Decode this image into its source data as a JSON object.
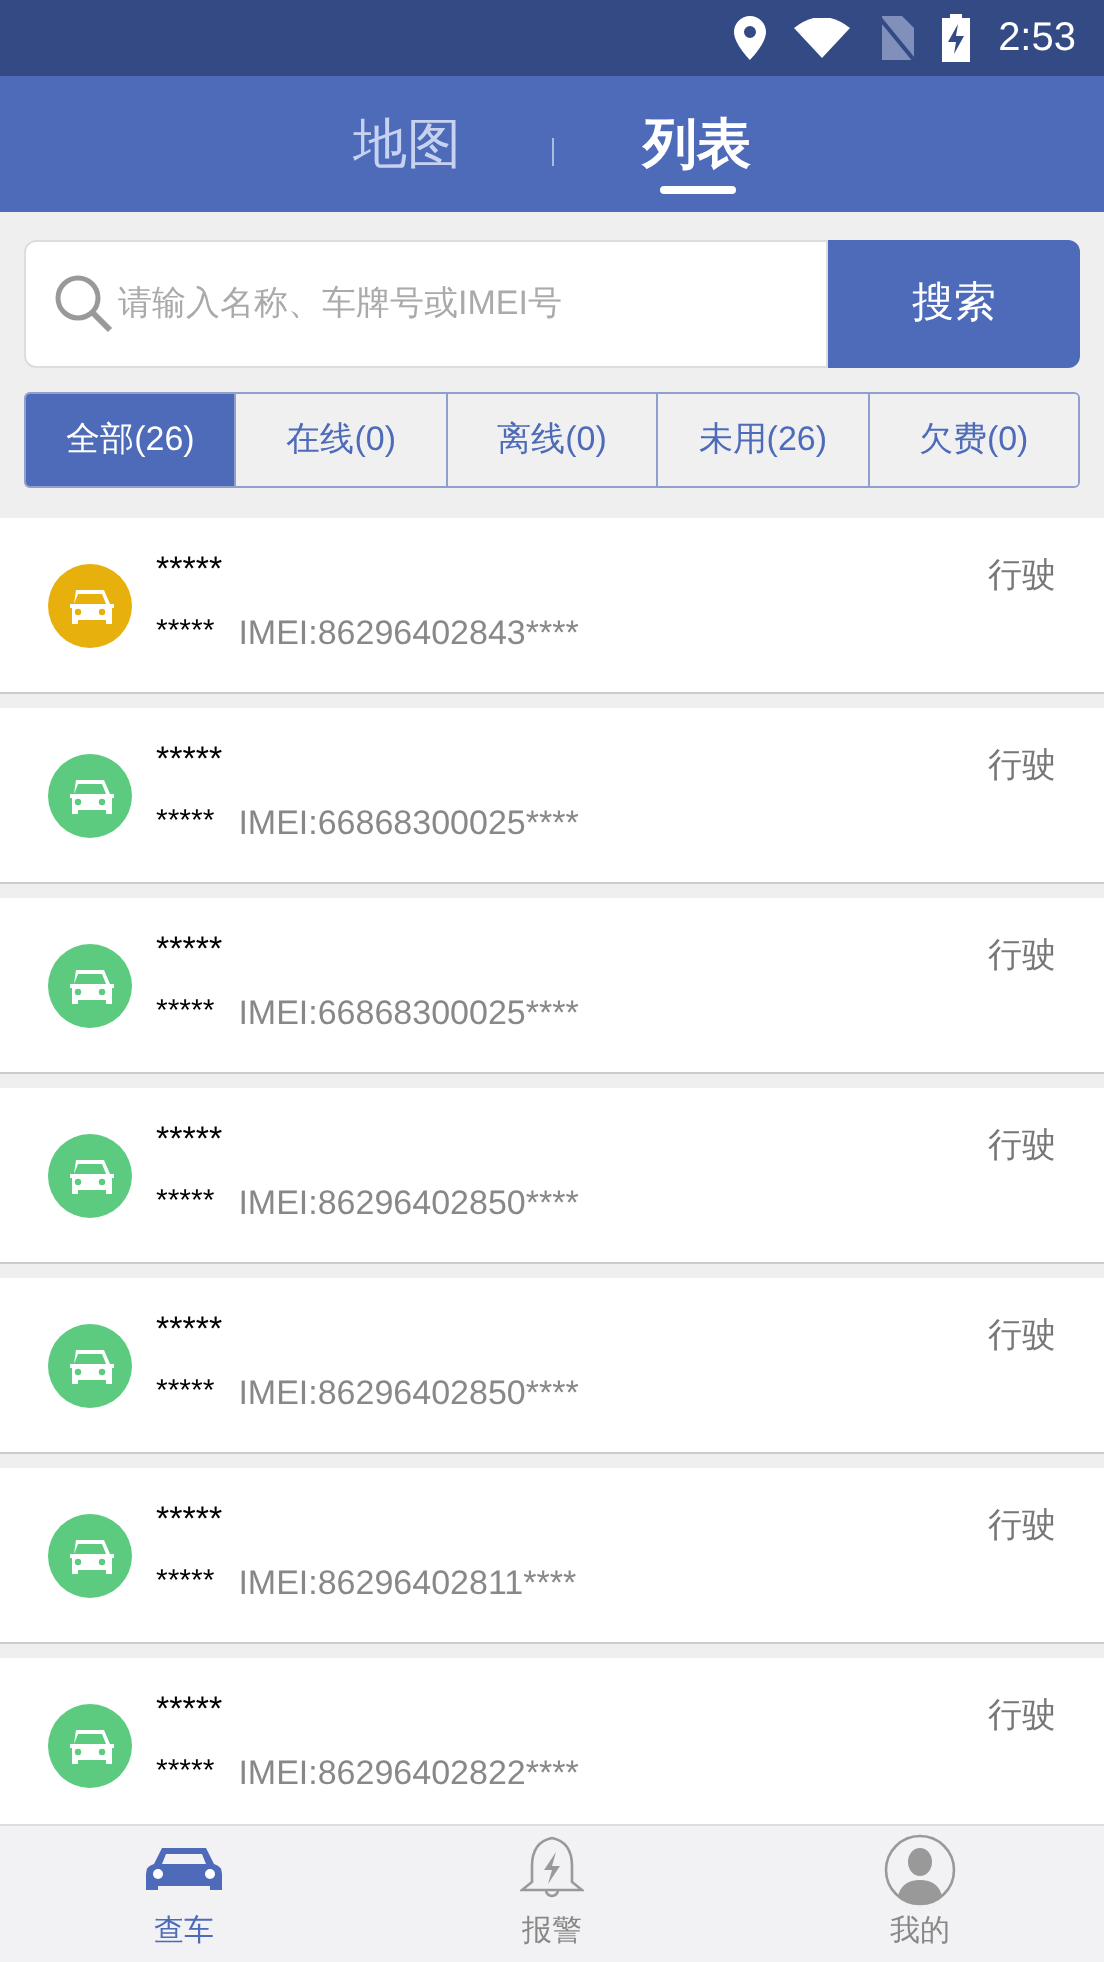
{
  "status_bar": {
    "time": "2:53"
  },
  "tabs": [
    {
      "label": "地图",
      "selected": false
    },
    {
      "label": "列表",
      "selected": true
    }
  ],
  "search": {
    "placeholder": "请输入名称、车牌号或IMEI号",
    "button": "搜索"
  },
  "filters": [
    {
      "label": "全部(26)",
      "selected": true
    },
    {
      "label": "在线(0)",
      "selected": false
    },
    {
      "label": "离线(0)",
      "selected": false
    },
    {
      "label": "未用(26)",
      "selected": false
    },
    {
      "label": "欠费(0)",
      "selected": false
    }
  ],
  "vehicles": [
    {
      "name": "*****",
      "plate": "*****",
      "imei": "IMEI:86296402843****",
      "status": "行驶",
      "color": "#e8b00c"
    },
    {
      "name": "*****",
      "plate": "*****",
      "imei": "IMEI:66868300025****",
      "status": "行驶",
      "color": "#5ccb7f"
    },
    {
      "name": "*****",
      "plate": "*****",
      "imei": "IMEI:66868300025****",
      "status": "行驶",
      "color": "#5ccb7f"
    },
    {
      "name": "*****",
      "plate": "*****",
      "imei": "IMEI:86296402850****",
      "status": "行驶",
      "color": "#5ccb7f"
    },
    {
      "name": "*****",
      "plate": "*****",
      "imei": "IMEI:86296402850****",
      "status": "行驶",
      "color": "#5ccb7f"
    },
    {
      "name": "*****",
      "plate": "*****",
      "imei": "IMEI:86296402811****",
      "status": "行驶",
      "color": "#5ccb7f"
    },
    {
      "name": "*****",
      "plate": "*****",
      "imei": "IMEI:86296402822****",
      "status": "行驶",
      "color": "#5ccb7f"
    }
  ],
  "nav": [
    {
      "label": "查车",
      "kind": "car",
      "selected": true
    },
    {
      "label": "报警",
      "kind": "alarm",
      "selected": false
    },
    {
      "label": "我的",
      "kind": "profile",
      "selected": false
    }
  ]
}
